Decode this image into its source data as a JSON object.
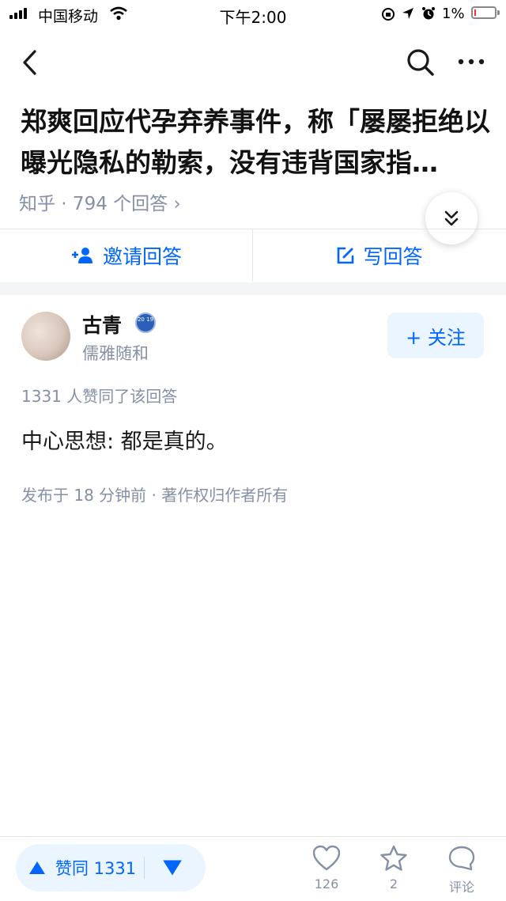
{
  "status_bar": {
    "carrier": "中国移动",
    "time": "下午2:00",
    "battery": "1%"
  },
  "nav": {
    "back_icon": "chevron-left-icon",
    "search_icon": "search-icon",
    "more_icon": "more-horizontal-icon"
  },
  "question": {
    "title": "郑爽回应代孕弃养事件，称「屡屡拒绝以曝光隐私的勒索，没有违背国家指…",
    "meta": "知乎 · 794 个回答 ›"
  },
  "actions": {
    "invite": "邀请回答",
    "write": "写回答"
  },
  "answer": {
    "author": "古青",
    "badge": "20 19",
    "bio": "儒雅随和",
    "follow": "+ 关注",
    "votes_line": "1331 人赞同了该回答",
    "content": "中心思想: 都是真的。",
    "published": "发布于 18 分钟前 · 著作权归作者所有"
  },
  "bottom": {
    "upvote": "赞同 1331",
    "likes": "126",
    "favorites": "2",
    "comment": "评论"
  },
  "colors": {
    "accent": "#0066ff",
    "muted": "#8590a6",
    "pill_bg": "#ebf5ff"
  }
}
